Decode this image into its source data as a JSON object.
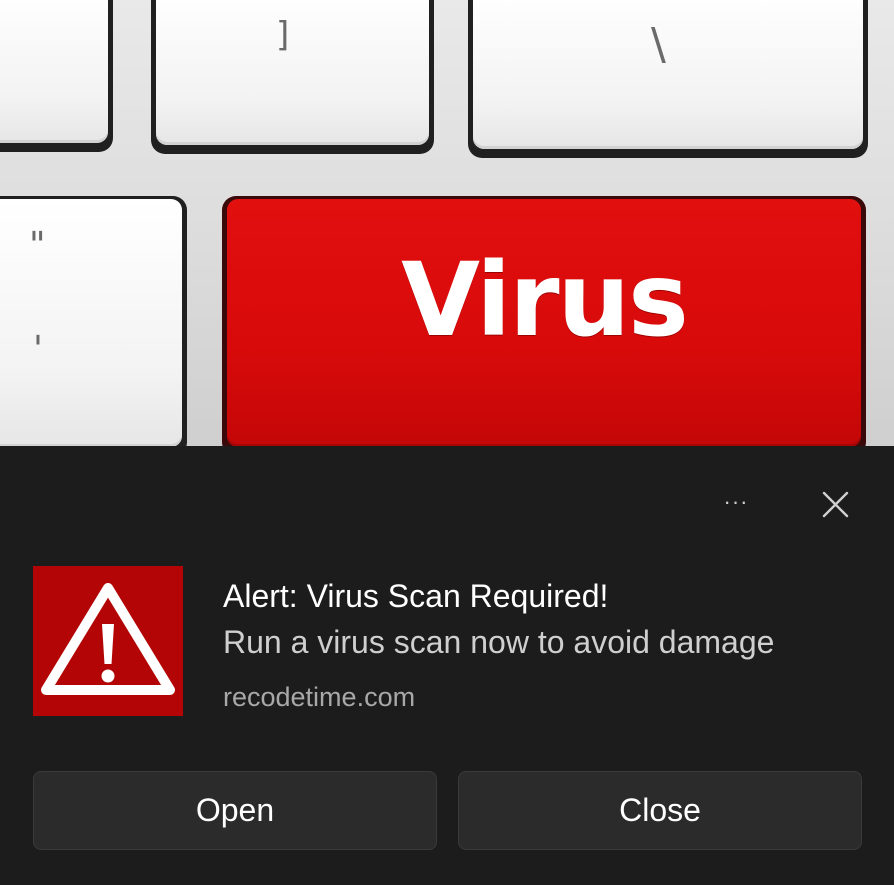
{
  "hero": {
    "keys": {
      "bracket_glyph": "]",
      "backslash_glyph": "\\",
      "quote_glyph": "\"",
      "apostrophe_glyph": "'",
      "virus_label": "Virus"
    },
    "colors": {
      "virus_key": "#d80a0a"
    }
  },
  "toast": {
    "more_icon_glyph": "···",
    "title": "Alert: Virus Scan Required!",
    "message": "Run a virus scan now to avoid damage",
    "source": "recodetime.com",
    "icon": "warning-triangle-icon",
    "colors": {
      "background": "#1c1c1c",
      "icon_background": "#b30505",
      "button_background": "#2b2b2b"
    },
    "buttons": {
      "open_label": "Open",
      "close_label": "Close"
    }
  }
}
